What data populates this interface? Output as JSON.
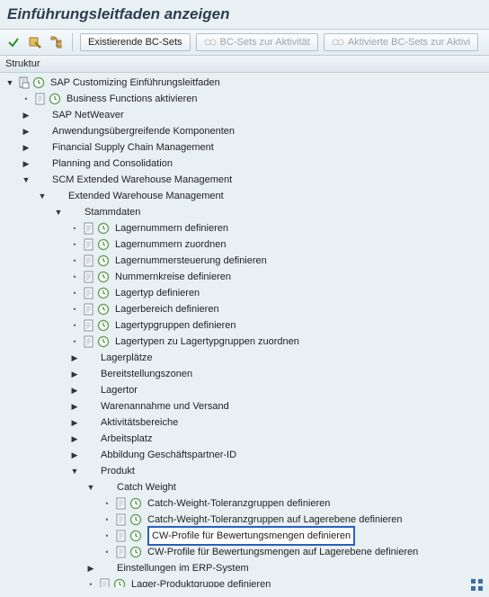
{
  "title": "Einführungsleitfaden anzeigen",
  "toolbar": {
    "existing_bcsets": "Existierende BC-Sets",
    "bcsets_activity": "BC-Sets zur Aktivität",
    "activated_bcsets": "Aktivierte BC-Sets zur Aktivi"
  },
  "struct_header": "Struktur",
  "tree": [
    {
      "depth": 0,
      "tw": "open",
      "icons": [
        "doc",
        "clock"
      ],
      "label": "SAP Customizing Einführungsleitfaden"
    },
    {
      "depth": 1,
      "tw": "dot",
      "icons": [
        "page",
        "clock"
      ],
      "label": "Business Functions aktivieren"
    },
    {
      "depth": 1,
      "tw": "closed",
      "icons": [],
      "label": "SAP NetWeaver"
    },
    {
      "depth": 1,
      "tw": "closed",
      "icons": [],
      "label": "Anwendungsübergreifende Komponenten"
    },
    {
      "depth": 1,
      "tw": "closed",
      "icons": [],
      "label": "Financial Supply Chain Management"
    },
    {
      "depth": 1,
      "tw": "closed",
      "icons": [],
      "label": "Planning and Consolidation"
    },
    {
      "depth": 1,
      "tw": "open",
      "icons": [],
      "label": "SCM Extended Warehouse Management"
    },
    {
      "depth": 2,
      "tw": "open",
      "icons": [],
      "label": "Extended Warehouse Management"
    },
    {
      "depth": 3,
      "tw": "open",
      "icons": [],
      "label": "Stammdaten"
    },
    {
      "depth": 4,
      "tw": "dot",
      "icons": [
        "page",
        "clock"
      ],
      "label": "Lagernummern definieren"
    },
    {
      "depth": 4,
      "tw": "dot",
      "icons": [
        "page",
        "clock"
      ],
      "label": "Lagernummern zuordnen"
    },
    {
      "depth": 4,
      "tw": "dot",
      "icons": [
        "page",
        "clock"
      ],
      "label": "Lagernummersteuerung definieren"
    },
    {
      "depth": 4,
      "tw": "dot",
      "icons": [
        "page",
        "clock"
      ],
      "label": "Nummernkreise definieren"
    },
    {
      "depth": 4,
      "tw": "dot",
      "icons": [
        "page",
        "clock"
      ],
      "label": "Lagertyp definieren"
    },
    {
      "depth": 4,
      "tw": "dot",
      "icons": [
        "page",
        "clock"
      ],
      "label": "Lagerbereich definieren"
    },
    {
      "depth": 4,
      "tw": "dot",
      "icons": [
        "page",
        "clock"
      ],
      "label": "Lagertypgruppen definieren"
    },
    {
      "depth": 4,
      "tw": "dot",
      "icons": [
        "page",
        "clock"
      ],
      "label": "Lagertypen zu Lagertypgruppen zuordnen"
    },
    {
      "depth": 4,
      "tw": "closed",
      "icons": [],
      "label": "Lagerplätze"
    },
    {
      "depth": 4,
      "tw": "closed",
      "icons": [],
      "label": "Bereitstellungszonen"
    },
    {
      "depth": 4,
      "tw": "closed",
      "icons": [],
      "label": "Lagertor"
    },
    {
      "depth": 4,
      "tw": "closed",
      "icons": [],
      "label": "Warenannahme und Versand"
    },
    {
      "depth": 4,
      "tw": "closed",
      "icons": [],
      "label": "Aktivitätsbereiche"
    },
    {
      "depth": 4,
      "tw": "closed",
      "icons": [],
      "label": "Arbeitsplatz"
    },
    {
      "depth": 4,
      "tw": "closed",
      "icons": [],
      "label": "Abbildung Geschäftspartner-ID"
    },
    {
      "depth": 4,
      "tw": "open",
      "icons": [],
      "label": "Produkt"
    },
    {
      "depth": 5,
      "tw": "open",
      "icons": [],
      "label": "Catch Weight"
    },
    {
      "depth": 6,
      "tw": "dot",
      "icons": [
        "page",
        "clock"
      ],
      "label": "Catch-Weight-Toleranzgruppen definieren"
    },
    {
      "depth": 6,
      "tw": "dot",
      "icons": [
        "page",
        "clock"
      ],
      "label": "Catch-Weight-Toleranzgruppen auf Lagerebene definieren"
    },
    {
      "depth": 6,
      "tw": "dot",
      "icons": [
        "page",
        "clock"
      ],
      "label": "CW-Profile für Bewertungsmengen definieren",
      "highlight": true
    },
    {
      "depth": 6,
      "tw": "dot",
      "icons": [
        "page",
        "clock"
      ],
      "label": "CW-Profile für Bewertungsmengen auf Lagerebene definieren"
    },
    {
      "depth": 5,
      "tw": "closed",
      "icons": [],
      "label": "Einstellungen im ERP-System"
    },
    {
      "depth": 5,
      "tw": "dot",
      "icons": [
        "page",
        "clock"
      ],
      "label": "Lager-Produktgruppe definieren"
    }
  ]
}
